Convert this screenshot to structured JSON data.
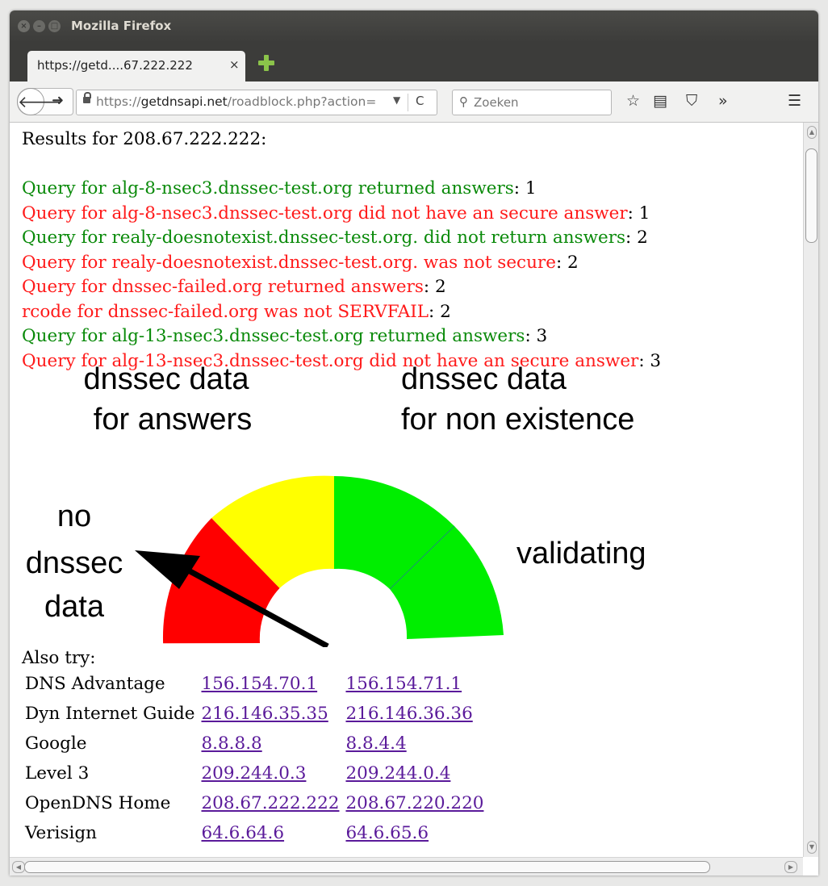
{
  "window": {
    "title": "Mozilla Firefox"
  },
  "tab": {
    "label": "https://getd....67.222.222",
    "close": "×"
  },
  "navbar": {
    "url_domain": "getdnsapi.net",
    "url_prefix": "https://",
    "url_path": "/roadblock.php?action=",
    "search_placeholder": "Zoeken",
    "overflow": "»"
  },
  "page": {
    "heading": "Results for 208.67.222.222:",
    "queries": [
      {
        "text": "Query for alg-8-nsec3.dnssec-test.org returned answers",
        "count": "1",
        "status": "green"
      },
      {
        "text": "Query for alg-8-nsec3.dnssec-test.org did not have an secure answer",
        "count": "1",
        "status": "red"
      },
      {
        "text": "Query for realy-doesnotexist.dnssec-test.org. did not return answers",
        "count": "2",
        "status": "green"
      },
      {
        "text": "Query for realy-doesnotexist.dnssec-test.org. was not secure",
        "count": "2",
        "status": "red"
      },
      {
        "text": "Query for dnssec-failed.org returned answers",
        "count": "2",
        "status": "red"
      },
      {
        "text": "rcode for dnssec-failed.org was not SERVFAIL",
        "count": "2",
        "status": "red"
      },
      {
        "text": "Query for alg-13-nsec3.dnssec-test.org returned answers",
        "count": "3",
        "status": "green"
      },
      {
        "text": "Query for alg-13-nsec3.dnssec-test.org did not have an secure answer",
        "count": "3",
        "status": "red"
      }
    ],
    "gauge": {
      "label_answers_1": "dnssec data",
      "label_answers_2": "for answers",
      "label_nonexist_1": "dnssec data",
      "label_nonexist_2": "for non existence",
      "label_left_1": "no",
      "label_left_2": "dnssec",
      "label_left_3": "data",
      "label_right": "validating",
      "colors": {
        "red": "#ff0000",
        "yellow": "#ffff00",
        "green": "#00ee00"
      }
    },
    "also_try": "Also try:",
    "resolvers": [
      {
        "name": "DNS Advantage",
        "ip1": "156.154.70.1",
        "ip2": "156.154.71.1"
      },
      {
        "name": "Dyn Internet Guide",
        "ip1": "216.146.35.35",
        "ip2": "216.146.36.36"
      },
      {
        "name": "Google",
        "ip1": "8.8.8.8",
        "ip2": "8.8.4.4"
      },
      {
        "name": "Level 3",
        "ip1": "209.244.0.3",
        "ip2": "209.244.0.4"
      },
      {
        "name": "OpenDNS Home",
        "ip1": "208.67.222.222",
        "ip2": "208.67.220.220"
      },
      {
        "name": "Verisign",
        "ip1": "64.6.64.6",
        "ip2": "64.6.65.6"
      }
    ]
  }
}
